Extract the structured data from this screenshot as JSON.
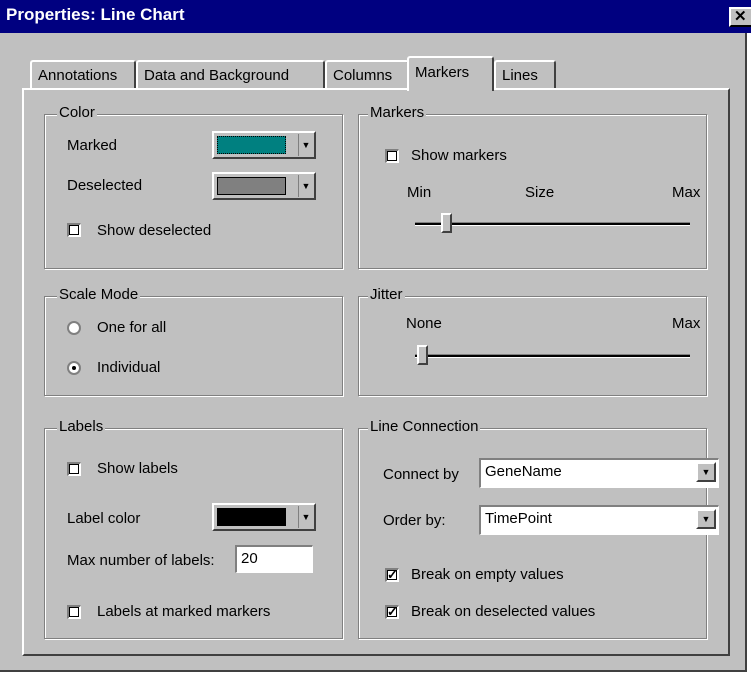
{
  "window": {
    "title": "Properties: Line Chart",
    "close_glyph": "✕"
  },
  "tabs": [
    {
      "label": "Annotations",
      "active": false
    },
    {
      "label": "Data and Background",
      "active": false
    },
    {
      "label": "Columns",
      "active": false
    },
    {
      "label": "Markers",
      "active": true
    },
    {
      "label": "Lines",
      "active": false
    }
  ],
  "color_group": {
    "legend": "Color",
    "marked_label": "Marked",
    "marked_color": "#008080",
    "deselected_label": "Deselected",
    "deselected_color": "#808080",
    "show_deselected_label": "Show deselected",
    "show_deselected_checked": false
  },
  "markers_group": {
    "legend": "Markers",
    "show_markers_label": "Show markers",
    "show_markers_checked": false,
    "min_label": "Min",
    "size_label": "Size",
    "max_label": "Max",
    "size_fraction": 0.12
  },
  "scale_group": {
    "legend": "Scale Mode",
    "one_for_all_label": "One for all",
    "individual_label": "Individual",
    "selected": "Individual"
  },
  "jitter_group": {
    "legend": "Jitter",
    "none_label": "None",
    "max_label": "Max",
    "jitter_fraction": 0.0
  },
  "labels_group": {
    "legend": "Labels",
    "show_labels_label": "Show labels",
    "show_labels_checked": false,
    "label_color_label": "Label color",
    "label_color": "#000000",
    "max_labels_label": "Max number of labels:",
    "max_labels_value": "20",
    "labels_at_marked_label": "Labels at marked markers",
    "labels_at_marked_checked": false
  },
  "line_group": {
    "legend": "Line Connection",
    "connect_by_label": "Connect by",
    "connect_by_value": "GeneName",
    "order_by_label": "Order by:",
    "order_by_value": "TimePoint",
    "break_empty_label": "Break on empty values",
    "break_empty_checked": true,
    "break_deselected_label": "Break on deselected values",
    "break_deselected_checked": true
  },
  "icons": {
    "dropdown": "▼",
    "check": "✓"
  }
}
